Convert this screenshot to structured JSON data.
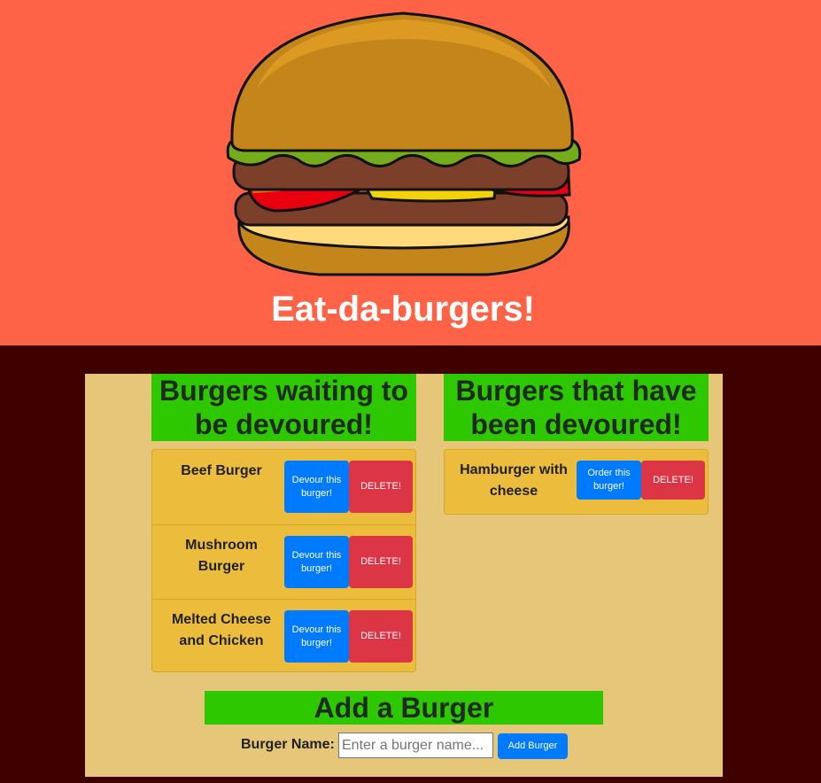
{
  "header": {
    "title": "Eat-da-burgers!",
    "logo_icon": "burger-illustration-icon",
    "background_color": "#ff6347"
  },
  "waiting": {
    "heading": "Burgers waiting to be devoured!",
    "burgers": [
      {
        "name": "Beef Burger",
        "devour_label": "Devour this burger!",
        "delete_label": "DELETE!"
      },
      {
        "name": "Mushroom Burger",
        "devour_label": "Devour this burger!",
        "delete_label": "DELETE!"
      },
      {
        "name": "Melted Cheese and Chicken",
        "devour_label": "Devour this burger!",
        "delete_label": "DELETE!"
      }
    ]
  },
  "devoured": {
    "heading": "Burgers that have been devoured!",
    "burgers": [
      {
        "name": "Hamburger with cheese",
        "order_label": "Order this burger!",
        "delete_label": "DELETE!"
      }
    ]
  },
  "add_form": {
    "heading": "Add a Burger",
    "label": "Burger Name:",
    "placeholder": "Enter a burger name...",
    "value": "",
    "submit_label": "Add Burger"
  },
  "colors": {
    "page_background": "#3f0000",
    "panel": "#e6c77a",
    "heading_band": "#2ec800",
    "list_background": "#ecbd3d",
    "primary_button": "#007bff",
    "danger_button": "#dc3545"
  }
}
